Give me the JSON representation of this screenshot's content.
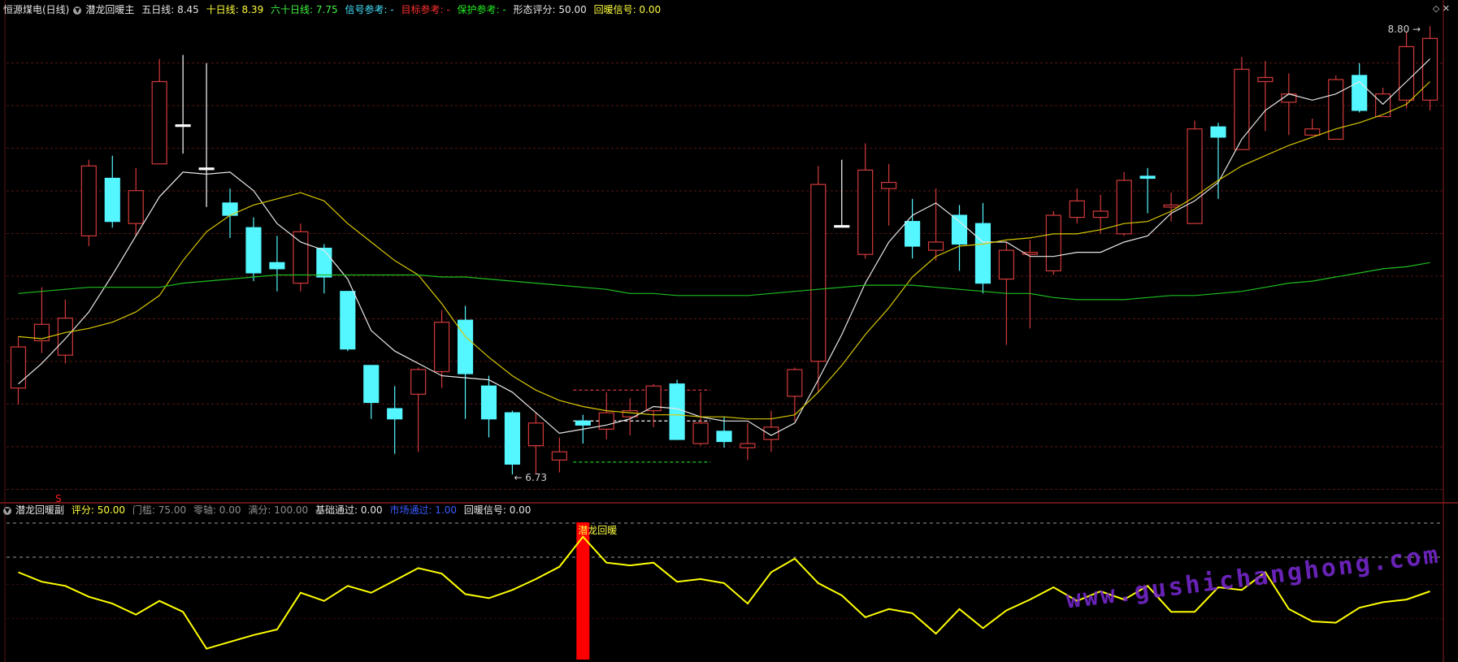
{
  "main_header": {
    "stock": "恒源煤电(日线)",
    "indicator": "潜龙回暖主",
    "ma5": "五日线: 8.45",
    "ma10": "十日线: 8.39",
    "ma60": "六十日线: 7.75",
    "signal_ref": "信号参考: -",
    "target_ref": "目标参考: -",
    "protect_ref": "保护参考: -",
    "pattern_score": "形态评分: 50.00",
    "recover_signal": "回暖信号: 0.00"
  },
  "sub_header": {
    "indicator": "潜龙回暖副",
    "score": "评分: 50.00",
    "threshold": "门槛: 75.00",
    "zero_axis": "零轴: 0.00",
    "full_score": "满分: 100.00",
    "base_pass": "基础通过: 0.00",
    "market_pass": "市场通过: 1.00",
    "recover_signal": "回暖信号: 0.00"
  },
  "annotations": {
    "high_label": "8.80",
    "low_label": "6.73",
    "signal_label": "潜龙回暖",
    "marker_s": "S"
  },
  "watermark": "www.gushichanghong.com",
  "colors": {
    "up": "#d43a3a",
    "down": "#54f6ff",
    "ma5": "#e8e8e8",
    "ma10": "#d9c800",
    "ma60": "#1ebd1e",
    "grid": "#5a1414",
    "score_line": "#ffff00",
    "signal_bar": "#ff0000"
  },
  "chart_data": [
    {
      "type": "candlestick",
      "title": "恒源煤电(日线)",
      "ylim": [
        6.6,
        8.95
      ],
      "series": [
        {
          "name": "K线",
          "ohlc": [
            [
              7.15,
              7.35,
              7.07,
              7.4
            ],
            [
              7.38,
              7.46,
              7.32,
              7.64
            ],
            [
              7.31,
              7.49,
              7.27,
              7.58
            ],
            [
              7.89,
              8.23,
              7.84,
              8.26
            ],
            [
              8.17,
              7.96,
              7.93,
              8.28
            ],
            [
              7.95,
              8.11,
              7.89,
              8.22
            ],
            [
              8.24,
              8.64,
              8.24,
              8.75
            ],
            [
              8.43,
              8.43,
              8.29,
              8.77
            ],
            [
              8.22,
              8.22,
              8.03,
              8.73
            ],
            [
              8.05,
              7.99,
              7.88,
              8.12
            ],
            [
              7.93,
              7.71,
              7.67,
              7.98
            ],
            [
              7.76,
              7.73,
              7.62,
              7.89
            ],
            [
              7.66,
              7.91,
              7.62,
              7.95
            ],
            [
              7.83,
              7.69,
              7.61,
              7.85
            ],
            [
              7.62,
              7.34,
              7.33,
              7.62
            ],
            [
              7.26,
              7.08,
              7.0,
              7.26
            ],
            [
              7.05,
              7.0,
              6.83,
              7.16
            ],
            [
              7.12,
              7.24,
              6.84,
              7.25
            ],
            [
              7.23,
              7.47,
              7.15,
              7.53
            ],
            [
              7.48,
              7.22,
              7.0,
              7.55
            ],
            [
              7.16,
              7.0,
              6.91,
              7.21
            ],
            [
              7.03,
              6.78,
              6.73,
              7.04
            ],
            [
              6.87,
              6.98,
              6.73,
              7.03
            ],
            [
              6.8,
              6.84,
              6.74,
              6.91
            ],
            [
              6.99,
              6.97,
              6.88,
              7.02
            ],
            [
              6.95,
              7.03,
              6.9,
              7.13
            ],
            [
              7.01,
              7.04,
              6.92,
              7.1
            ],
            [
              7.04,
              7.16,
              6.96,
              7.17
            ],
            [
              7.17,
              6.9,
              6.92,
              7.19
            ],
            [
              6.88,
              6.98,
              6.87,
              7.13
            ],
            [
              6.94,
              6.89,
              6.86,
              7.01
            ],
            [
              6.86,
              6.88,
              6.8,
              6.98
            ],
            [
              6.9,
              6.96,
              6.84,
              7.04
            ],
            [
              7.11,
              7.24,
              6.99,
              7.25
            ],
            [
              7.28,
              8.14,
              7.13,
              8.23
            ],
            [
              7.94,
              7.94,
              7.94,
              8.26
            ],
            [
              7.8,
              8.21,
              7.78,
              8.34
            ],
            [
              8.12,
              8.15,
              7.94,
              8.24
            ],
            [
              7.96,
              7.84,
              7.78,
              8.07
            ],
            [
              7.82,
              7.86,
              7.77,
              8.12
            ],
            [
              7.99,
              7.85,
              7.72,
              8.04
            ],
            [
              7.95,
              7.66,
              7.61,
              8.05
            ],
            [
              7.68,
              7.82,
              7.36,
              7.86
            ],
            [
              7.8,
              7.81,
              7.44,
              7.87
            ],
            [
              7.72,
              7.99,
              7.7,
              8.01
            ],
            [
              7.98,
              8.06,
              7.95,
              8.12
            ],
            [
              7.98,
              8.01,
              7.9,
              8.09
            ],
            [
              7.9,
              8.16,
              7.89,
              8.2
            ],
            [
              8.18,
              8.17,
              8.0,
              8.22
            ],
            [
              8.03,
              8.04,
              7.96,
              8.1
            ],
            [
              7.95,
              8.41,
              7.96,
              8.45
            ],
            [
              8.42,
              8.37,
              8.07,
              8.44
            ],
            [
              8.31,
              8.7,
              8.32,
              8.76
            ],
            [
              8.64,
              8.66,
              8.4,
              8.74
            ],
            [
              8.54,
              8.58,
              8.38,
              8.68
            ],
            [
              8.38,
              8.41,
              8.38,
              8.46
            ],
            [
              8.36,
              8.65,
              8.46,
              8.67
            ],
            [
              8.67,
              8.5,
              8.49,
              8.73
            ],
            [
              8.47,
              8.58,
              8.49,
              8.61
            ],
            [
              8.55,
              8.81,
              8.51,
              8.88
            ],
            [
              8.55,
              8.85,
              8.5,
              8.91
            ]
          ]
        },
        {
          "name": "五日线",
          "values": [
            7.17,
            7.27,
            7.39,
            7.52,
            7.7,
            7.89,
            8.08,
            8.2,
            8.19,
            8.2,
            8.11,
            7.95,
            7.86,
            7.82,
            7.68,
            7.43,
            7.33,
            7.27,
            7.21,
            7.2,
            7.19,
            7.13,
            7.03,
            6.93,
            6.95,
            6.97,
            7.0,
            7.06,
            7.05,
            7.01,
            6.99,
            6.99,
            6.92,
            6.98,
            7.19,
            7.41,
            7.66,
            7.86,
            7.99,
            8.05,
            7.96,
            7.86,
            7.86,
            7.79,
            7.79,
            7.81,
            7.81,
            7.86,
            7.89,
            8.0,
            8.06,
            8.15,
            8.36,
            8.5,
            8.58,
            8.55,
            8.58,
            8.64,
            8.53,
            8.64,
            8.75
          ]
        },
        {
          "name": "十日线",
          "values": [
            7.4,
            7.39,
            7.42,
            7.44,
            7.47,
            7.52,
            7.6,
            7.77,
            7.91,
            7.99,
            8.04,
            8.07,
            8.1,
            8.06,
            7.95,
            7.86,
            7.77,
            7.7,
            7.56,
            7.4,
            7.3,
            7.21,
            7.14,
            7.09,
            7.06,
            7.04,
            7.03,
            7.02,
            7.02,
            7.01,
            7.01,
            7.0,
            7.0,
            7.02,
            7.13,
            7.26,
            7.41,
            7.54,
            7.69,
            7.79,
            7.84,
            7.85,
            7.87,
            7.88,
            7.9,
            7.9,
            7.92,
            7.95,
            7.96,
            8.01,
            8.08,
            8.16,
            8.23,
            8.28,
            8.33,
            8.37,
            8.41,
            8.44,
            8.48,
            8.53,
            8.64
          ]
        },
        {
          "name": "六十日线",
          "values": [
            7.61,
            7.62,
            7.63,
            7.64,
            7.64,
            7.64,
            7.64,
            7.66,
            7.67,
            7.68,
            7.69,
            7.7,
            7.7,
            7.7,
            7.7,
            7.7,
            7.7,
            7.7,
            7.69,
            7.69,
            7.68,
            7.67,
            7.66,
            7.65,
            7.64,
            7.63,
            7.61,
            7.61,
            7.6,
            7.6,
            7.6,
            7.6,
            7.61,
            7.62,
            7.63,
            7.64,
            7.65,
            7.65,
            7.65,
            7.64,
            7.63,
            7.62,
            7.61,
            7.61,
            7.59,
            7.58,
            7.58,
            7.58,
            7.59,
            7.6,
            7.6,
            7.61,
            7.62,
            7.64,
            7.66,
            7.67,
            7.69,
            7.71,
            7.73,
            7.74,
            7.76
          ]
        }
      ],
      "dashed_levels": [
        {
          "value": 7.14,
          "color": "#d43a3a",
          "from": 24,
          "to": 29
        },
        {
          "value": 6.99,
          "color": "#ffffff",
          "from": 24,
          "to": 29
        },
        {
          "value": 6.79,
          "color": "#22cc22",
          "from": 24,
          "to": 29
        }
      ]
    },
    {
      "type": "line",
      "title": "潜龙回暖副",
      "ylim": [
        0,
        100
      ],
      "reference_lines": [
        75,
        100
      ],
      "series": [
        {
          "name": "评分",
          "values": [
            64,
            57,
            54,
            46,
            41,
            33,
            43,
            35,
            8,
            13,
            18,
            22,
            49,
            43,
            54,
            49,
            58,
            67,
            63,
            48,
            45,
            51,
            59,
            68,
            90,
            71,
            69,
            71,
            57,
            59,
            56,
            41,
            64,
            74,
            56,
            47,
            31,
            37,
            34,
            19,
            37,
            23,
            36,
            44,
            53,
            43,
            50,
            44,
            54,
            35,
            35,
            53,
            51,
            64,
            37,
            28,
            27,
            38,
            42,
            44,
            50
          ]
        }
      ],
      "signal_bars": [
        {
          "index": 24,
          "label": "潜龙回暖"
        }
      ]
    }
  ]
}
